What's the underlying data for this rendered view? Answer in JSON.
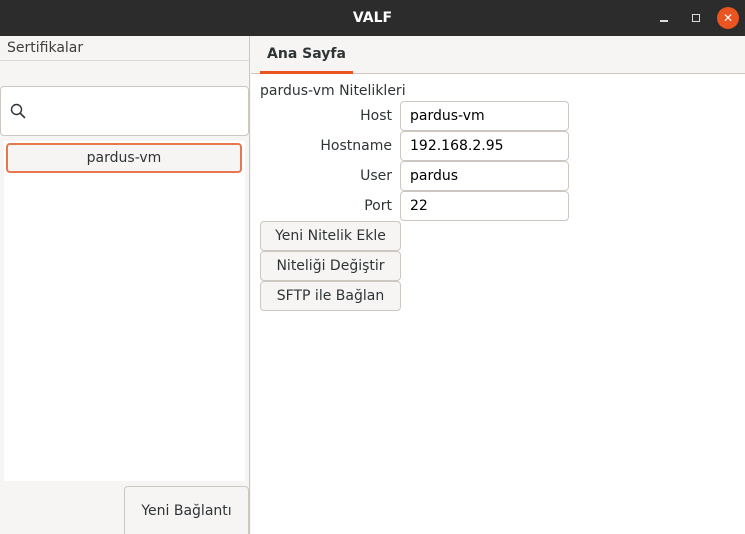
{
  "window": {
    "title": "VALF",
    "controls": {
      "minimize_icon": "minimize-icon",
      "maximize_icon": "maximize-icon",
      "close_icon": "close-icon"
    },
    "close_color": "#e95420"
  },
  "sidebar": {
    "header": "Sertifikalar",
    "search": {
      "placeholder": "",
      "value": "",
      "icon": "search-icon"
    },
    "items": [
      {
        "label": "pardus-vm",
        "selected": true
      }
    ],
    "new_connection_label": "Yeni Bağlantı"
  },
  "main": {
    "tabs": [
      {
        "label": "Ana Sayfa",
        "active": true
      }
    ],
    "section_title": "pardus-vm Nitelikleri",
    "fields": [
      {
        "label": "Host",
        "value": "pardus-vm"
      },
      {
        "label": "Hostname",
        "value": "192.168.2.95"
      },
      {
        "label": "User",
        "value": "pardus"
      },
      {
        "label": "Port",
        "value": "22"
      }
    ],
    "actions": [
      {
        "label": "Yeni Nitelik Ekle"
      },
      {
        "label": "Niteliği Değiştir"
      },
      {
        "label": "SFTP ile Bağlan"
      }
    ]
  },
  "colors": {
    "accent": "#e95420",
    "selection_border": "#e9774e",
    "titlebar": "#2c2c2c"
  }
}
